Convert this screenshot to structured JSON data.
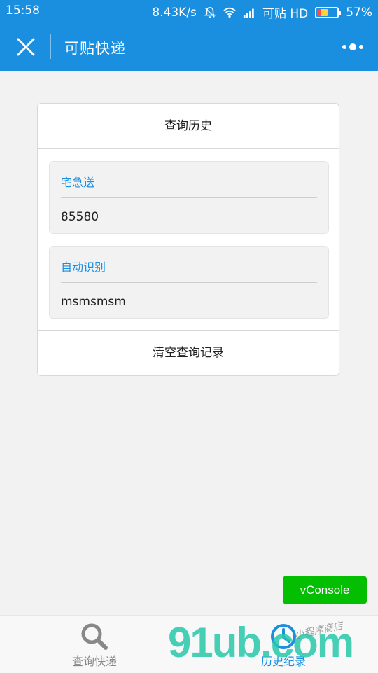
{
  "status_bar": {
    "time": "15:58",
    "speed": "8.43K/s",
    "carrier": "可贴 HD",
    "battery": "57%",
    "battery_level": 0.57,
    "battery_colors": {
      "low": "#ff4b4b",
      "mid": "#ffd23c"
    },
    "icons": [
      "bell-off-icon",
      "wifi-icon",
      "signal-icon",
      "battery-icon"
    ]
  },
  "nav": {
    "title": "可贴快递",
    "close_icon": "close-icon",
    "more_icon": "more-dots-icon",
    "color": "#1a8fe0"
  },
  "card": {
    "title": "查询历史",
    "items": [
      {
        "company": "宅急送",
        "number": "85580"
      },
      {
        "company": "自动识别",
        "number": "msmsmsm"
      }
    ],
    "clear_label": "清空查询记录"
  },
  "vconsole": {
    "label": "vConsole",
    "color": "#04be02"
  },
  "tabbar": {
    "tabs": [
      {
        "label": "查询快递",
        "icon": "search-icon",
        "active": false
      },
      {
        "label": "历史纪录",
        "icon": "clock-icon",
        "active": true
      }
    ],
    "active_color": "#1a8fe0",
    "inactive_color": "#888888"
  },
  "watermark": {
    "main": "91ub.com",
    "small": "小程序商店"
  }
}
